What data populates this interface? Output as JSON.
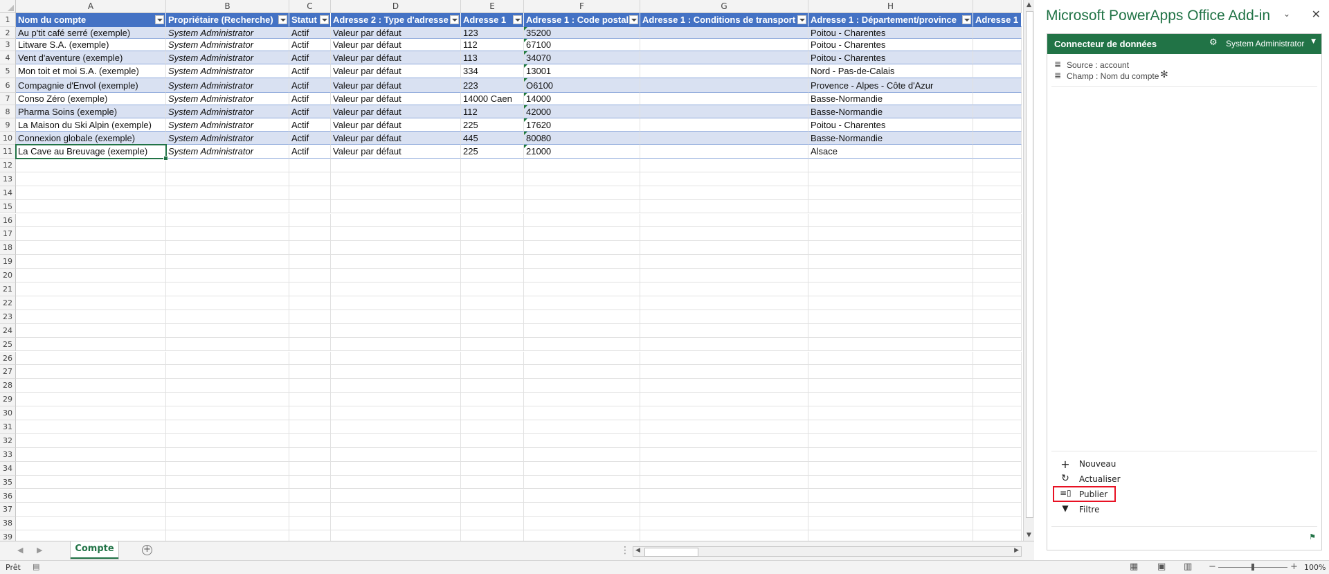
{
  "sheet": {
    "columns": [
      "A",
      "B",
      "C",
      "D",
      "E",
      "F",
      "G",
      "H"
    ],
    "row_numbers": [
      "1",
      "2",
      "3",
      "4",
      "5",
      "6",
      "7",
      "8",
      "9",
      "10",
      "11",
      "12",
      "13",
      "14",
      "15",
      "16",
      "17",
      "18",
      "19",
      "20",
      "21",
      "22",
      "23",
      "24",
      "25",
      "26",
      "27",
      "28",
      "29",
      "30",
      "31",
      "32",
      "33",
      "34",
      "35",
      "36",
      "37",
      "38",
      "39"
    ],
    "headers": [
      "Nom du compte",
      "Propriétaire (Recherche)",
      "Statut",
      "Adresse 2 : Type d'adresse",
      "Adresse 1",
      "Adresse 1 : Code postal",
      "Adresse 1 : Conditions de transport",
      "Adresse 1 : Département/province",
      "Adresse 1"
    ],
    "rows": [
      [
        "Au p'tit café serré (exemple)",
        "System Administrator",
        "Actif",
        "Valeur par défaut",
        "123",
        "35200",
        "",
        "Poitou - Charentes"
      ],
      [
        "Litware S.A. (exemple)",
        "System Administrator",
        "Actif",
        "Valeur par défaut",
        "112",
        "67100",
        "",
        "Poitou - Charentes"
      ],
      [
        "Vent d'aventure (exemple)",
        "System Administrator",
        "Actif",
        "Valeur par défaut",
        "113",
        "34070",
        "",
        "Poitou - Charentes"
      ],
      [
        "Mon toit et moi S.A. (exemple)",
        "System Administrator",
        "Actif",
        "Valeur par défaut",
        "334",
        "13001",
        "",
        "Nord - Pas-de-Calais"
      ],
      [
        "Compagnie d'Envol (exemple)",
        "System Administrator",
        "Actif",
        "Valeur par défaut",
        "223",
        "O6100",
        "",
        "Provence - Alpes - Côte d'Azur"
      ],
      [
        "Conso Zéro (exemple)",
        "System Administrator",
        "Actif",
        "Valeur par défaut",
        "14000 Caen",
        "14000",
        "",
        "Basse-Normandie"
      ],
      [
        "Pharma Soins (exemple)",
        "System Administrator",
        "Actif",
        "Valeur par défaut",
        "112",
        "42000",
        "",
        "Basse-Normandie"
      ],
      [
        "La Maison du Ski Alpin (exemple)",
        "System Administrator",
        "Actif",
        "Valeur par défaut",
        "225",
        "17620",
        "",
        "Poitou - Charentes"
      ],
      [
        "Connexion globale (exemple)",
        "System Administrator",
        "Actif",
        "Valeur par défaut",
        "445",
        "80080",
        "",
        "Basse-Normandie"
      ],
      [
        "La Cave au Breuvage (exemple)",
        "System Administrator",
        "Actif",
        "Valeur par défaut",
        "225",
        "21000",
        "",
        "Alsace"
      ]
    ],
    "tab_name": "Compte"
  },
  "status": {
    "ready": "Prêt",
    "zoom": "100%"
  },
  "pane": {
    "title": "Microsoft PowerApps Office Add-in",
    "header_title": "Connecteur de données",
    "user": "System Administrator",
    "source": "Source : account",
    "field": "Champ : Nom du compte",
    "actions": [
      "Nouveau",
      "Actualiser",
      "Publier",
      "Filtre"
    ],
    "highlight_color": "#e81123",
    "accent_color": "#217346"
  }
}
